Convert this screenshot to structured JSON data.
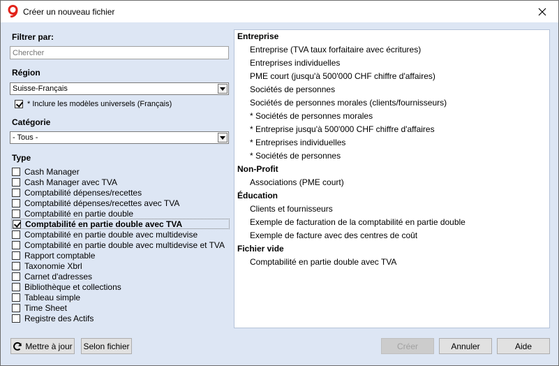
{
  "window": {
    "title": "Créer un nouveau fichier"
  },
  "filter": {
    "label": "Filtrer par:",
    "search_placeholder": "Chercher"
  },
  "region": {
    "label": "Région",
    "selected": "Suisse-Français",
    "include_universal_label": "* Inclure les modèles universels (Français)",
    "include_universal_checked": true
  },
  "category": {
    "label": "Catégorie",
    "selected": "- Tous -"
  },
  "type": {
    "label": "Type",
    "items": [
      {
        "label": "Cash Manager",
        "checked": false
      },
      {
        "label": "Cash Manager avec TVA",
        "checked": false
      },
      {
        "label": "Comptabilité dépenses/recettes",
        "checked": false
      },
      {
        "label": "Comptabilité dépenses/recettes avec TVA",
        "checked": false
      },
      {
        "label": "Comptabilité en partie double",
        "checked": false
      },
      {
        "label": "Comptabilité en partie double avec TVA",
        "checked": true
      },
      {
        "label": "Comptabilité en partie double avec multidevise",
        "checked": false
      },
      {
        "label": "Comptabilité en partie double avec multidevise et TVA",
        "checked": false
      },
      {
        "label": "Rapport comptable",
        "checked": false
      },
      {
        "label": "Taxonomie Xbrl",
        "checked": false
      },
      {
        "label": "Carnet d'adresses",
        "checked": false
      },
      {
        "label": "Bibliothèque et collections",
        "checked": false
      },
      {
        "label": "Tableau simple",
        "checked": false
      },
      {
        "label": "Time Sheet",
        "checked": false
      },
      {
        "label": "Registre des Actifs",
        "checked": false
      }
    ]
  },
  "templates": [
    {
      "group": "Entreprise",
      "items": [
        "Entreprise (TVA taux forfaitaire avec écritures)",
        "Entreprises individuelles",
        "PME court (jusqu'à 500'000 CHF chiffre d'affaires)",
        "Sociétés de personnes",
        "Sociétés de personnes morales (clients/fournisseurs)",
        "*  Sociétés de personnes morales",
        "* Entreprise jusqu'à 500'000 CHF chiffre d'affaires",
        "* Entreprises individuelles",
        "* Sociétés de personnes"
      ]
    },
    {
      "group": "Non-Profit",
      "items": [
        "Associations (PME court)"
      ]
    },
    {
      "group": "Éducation",
      "items": [
        "Clients et fournisseurs",
        "Exemple de facturation de la comptabilité en partie double",
        "Exemple de facture avec des centres de coût"
      ]
    },
    {
      "group": "Fichier vide",
      "items": [
        "Comptabilité en partie double avec TVA"
      ]
    }
  ],
  "buttons": {
    "update": "Mettre à jour",
    "by_file": "Selon fichier",
    "create": "Créer",
    "cancel": "Annuler",
    "help": "Aide"
  },
  "colors": {
    "logo_red": "#e2231a",
    "panel_bg": "#dde6f4"
  }
}
